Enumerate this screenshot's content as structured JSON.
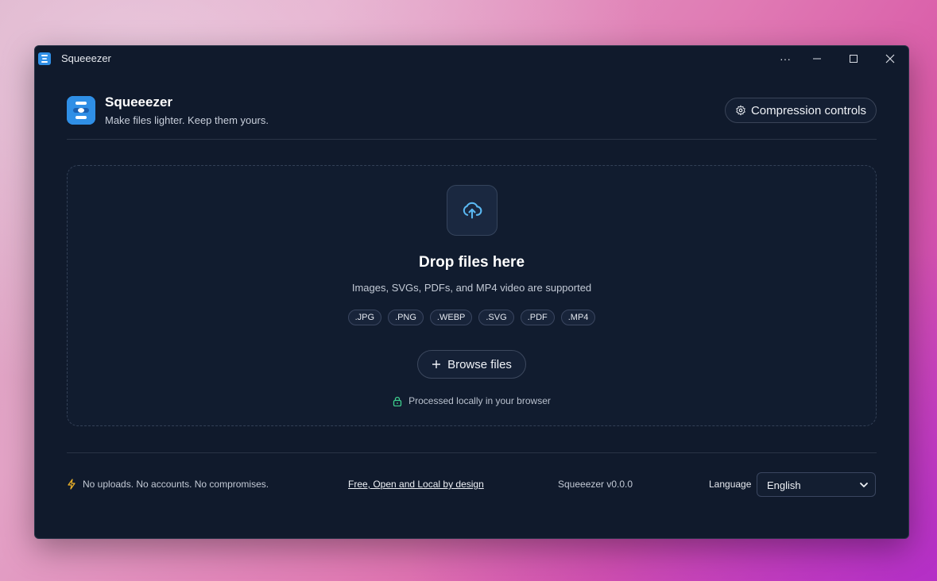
{
  "window": {
    "title": "Squeeezer",
    "controls": {
      "more": "···",
      "minimize": "–",
      "maximize": "□",
      "close": "✕"
    }
  },
  "header": {
    "app_name": "Squeeezer",
    "tagline": "Make files lighter. Keep them yours.",
    "compression_button": "Compression controls"
  },
  "dropzone": {
    "title": "Drop files here",
    "subtitle": "Images, SVGs, PDFs, and MP4 video are supported",
    "formats": [
      ".JPG",
      ".PNG",
      ".WEBP",
      ".SVG",
      ".PDF",
      ".MP4"
    ],
    "browse_button": "Browse files",
    "local_note": "Processed locally in your browser"
  },
  "footer": {
    "privacy": "No uploads. No accounts. No compromises.",
    "link": "Free, Open and Local by design",
    "version": "Squeeezer v0.0.0",
    "language_label": "Language",
    "language_value": "English"
  },
  "colors": {
    "window_bg": "#101a2c",
    "accent": "#2f8fe6",
    "upload_icon": "#5ab8f2",
    "lock_icon": "#3ecf8e",
    "bolt_icon": "#f0b429"
  },
  "icons": {
    "app": "squeeezer-logo-icon",
    "settings": "gear-icon",
    "upload": "cloud-upload-icon",
    "browse": "plus-icon",
    "local": "lock-icon",
    "footer_left": "bolt-icon",
    "select": "chevron-down-icon"
  }
}
